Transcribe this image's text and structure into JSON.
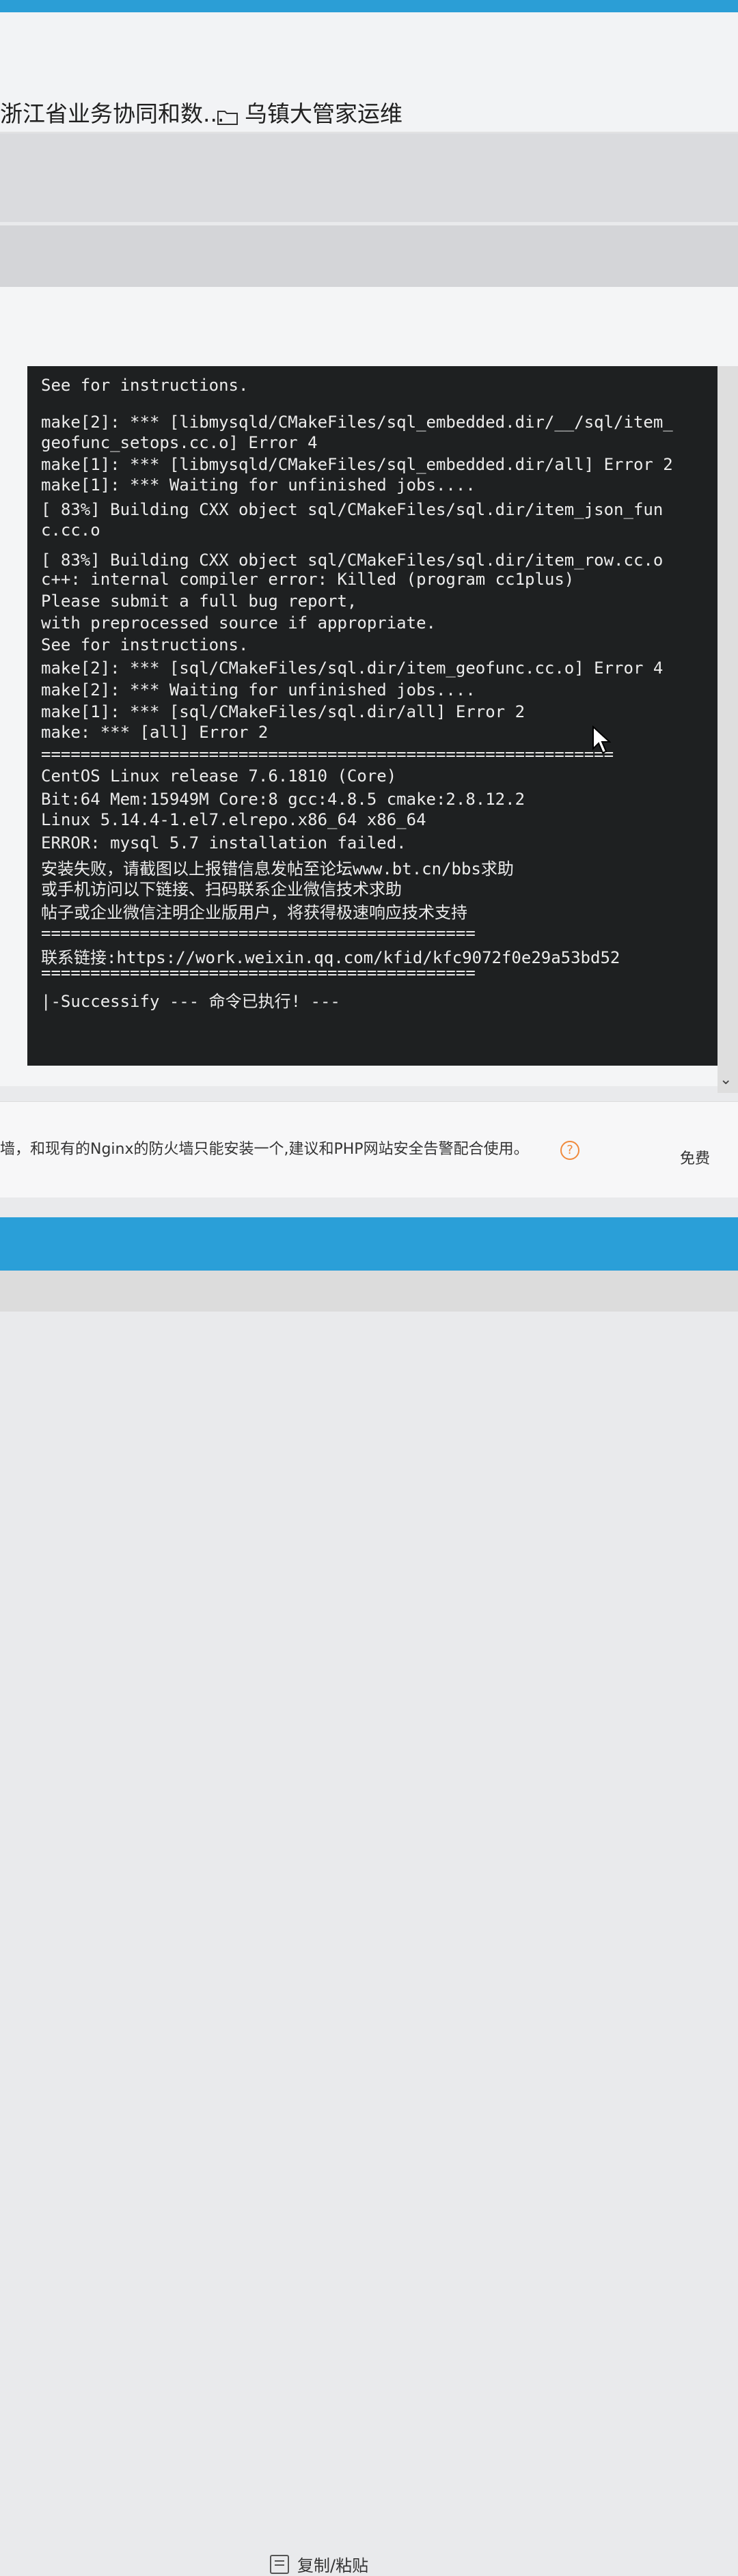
{
  "bookmarks": [
    {
      "label": "浙江省业务协同和数..."
    },
    {
      "label": "乌镇大管家运维",
      "icon": "folder-icon"
    }
  ],
  "terminal": {
    "lines": [
      "See for instructions.",
      "make[2]: *** [libmysqld/CMakeFiles/sql_embedded.dir/__/sql/item_",
      "geofunc_setops.cc.o] Error 4",
      "make[1]: *** [libmysqld/CMakeFiles/sql_embedded.dir/all] Error 2",
      "make[1]: *** Waiting for unfinished jobs....",
      "[ 83%] Building CXX object sql/CMakeFiles/sql.dir/item_json_fun",
      "c.cc.o",
      "[ 83%] Building CXX object sql/CMakeFiles/sql.dir/item_row.cc.o",
      "c++: internal compiler error: Killed (program cc1plus)",
      "Please submit a full bug report,",
      "with preprocessed source if appropriate.",
      "See for instructions.",
      "make[2]: *** [sql/CMakeFiles/sql.dir/item_geofunc.cc.o] Error 4",
      "make[2]: *** Waiting for unfinished jobs....",
      "make[1]: *** [sql/CMakeFiles/sql.dir/all] Error 2",
      "make: *** [all] Error 2",
      "==========================================================",
      "CentOS Linux release 7.6.1810 (Core)",
      "Bit:64 Mem:15949M Core:8 gcc:4.8.5 cmake:2.8.12.2",
      "Linux 5.14.4-1.el7.elrepo.x86_64 x86_64",
      "ERROR: mysql 5.7 installation failed.",
      "安装失败，请截图以上报错信息发帖至论坛www.bt.cn/bbs求助",
      "或手机访问以下链接、扫码联系企业微信技术求助",
      "帖子或企业微信注明企业版用户，将获得极速响应技术支持",
      "============================================",
      "联系链接:https://work.weixin.qq.com/kfid/kfc9072f0e29a53bd52",
      "============================================",
      "|-Successify --- 命令已执行! ---"
    ]
  },
  "description": {
    "text": "墙，和现有的Nginx的防火墙只能安装一个,建议和PHP网站安全告警配合使用。",
    "price": "免费"
  },
  "footer": {
    "copy_label": "复制/粘贴"
  },
  "colors": {
    "accent": "#2a9fd8",
    "terminal_bg": "#1e2021",
    "help_icon": "#f08a3c"
  }
}
